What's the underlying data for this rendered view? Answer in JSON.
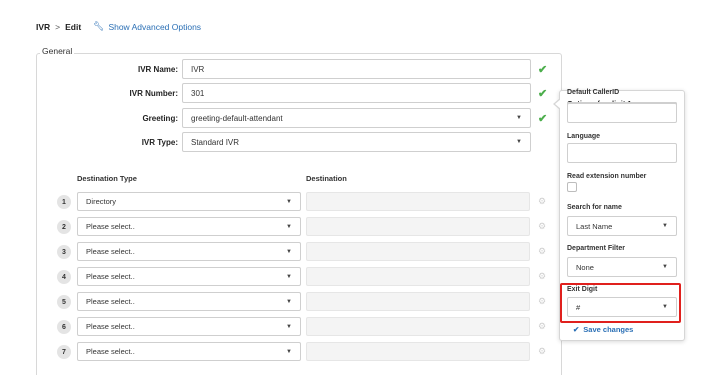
{
  "breadcrumb": {
    "root": "IVR",
    "separator": ">",
    "current": "Edit"
  },
  "advanced_link": "Show Advanced Options",
  "general": {
    "legend": "General",
    "fields": {
      "name": {
        "label": "IVR Name:",
        "value": "IVR"
      },
      "number": {
        "label": "IVR Number:",
        "value": "301"
      },
      "greeting": {
        "label": "Greeting:",
        "value": "greeting-default-attendant"
      },
      "type": {
        "label": "IVR Type:",
        "value": "Standard IVR"
      }
    },
    "columns": {
      "destination_type": "Destination Type",
      "destination": "Destination"
    },
    "rows": [
      {
        "num": "1",
        "type": "Directory"
      },
      {
        "num": "2",
        "type": "Please select.."
      },
      {
        "num": "3",
        "type": "Please select.."
      },
      {
        "num": "4",
        "type": "Please select.."
      },
      {
        "num": "5",
        "type": "Please select.."
      },
      {
        "num": "6",
        "type": "Please select.."
      },
      {
        "num": "7",
        "type": "Please select.."
      }
    ]
  },
  "panel": {
    "title": "Options for digit 1",
    "default_callerid": {
      "label": "Default CallerID",
      "value": ""
    },
    "language": {
      "label": "Language",
      "value": ""
    },
    "read_extension": {
      "label": "Read extension number",
      "checked": false
    },
    "search_for_name": {
      "label": "Search for name",
      "value": "Last Name"
    },
    "department_filter": {
      "label": "Department Filter",
      "value": "None"
    },
    "exit_digit": {
      "label": "Exit Digit",
      "value": "#"
    },
    "save_label": "Save changes"
  },
  "colors": {
    "accent": "#2a6fb5",
    "check": "#4cae4c",
    "highlight": "#e0201d"
  },
  "icons": {
    "advanced": "wrench-icon",
    "valid": "check-icon",
    "row_action": "gear-icon",
    "save": "checkmark-icon",
    "dropdown": "caret-down-icon"
  }
}
